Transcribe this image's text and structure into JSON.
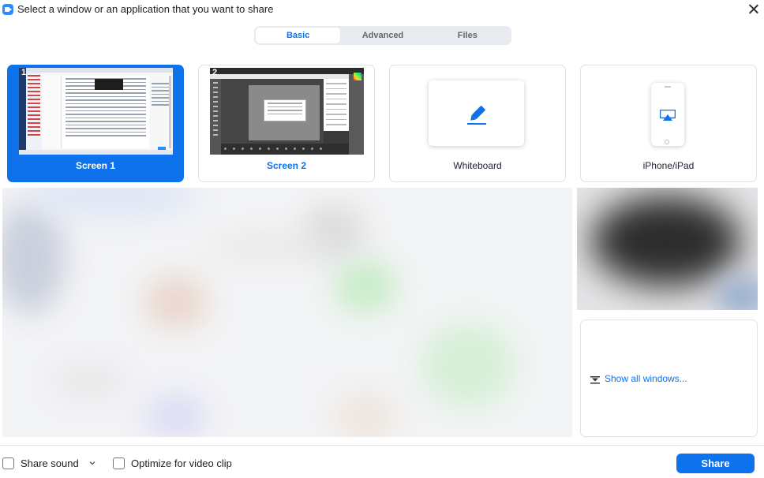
{
  "window": {
    "title": "Select a window or an application that you want to share",
    "app_icon": "zoom-camera-icon",
    "close_icon": "close-icon"
  },
  "tabs": [
    {
      "label": "Basic",
      "active": true
    },
    {
      "label": "Advanced",
      "active": false
    },
    {
      "label": "Files",
      "active": false
    }
  ],
  "cards": {
    "screen1": {
      "number": "1",
      "label": "Screen 1",
      "selected": true
    },
    "screen2": {
      "number": "2",
      "label": "Screen 2",
      "selected": false
    },
    "whiteboard": {
      "label": "Whiteboard",
      "icon": "pen-icon"
    },
    "iphone": {
      "label": "iPhone/iPad",
      "icon": "airplay-icon"
    }
  },
  "show_all": {
    "label": "Show all windows...",
    "icon": "expand-down-icon"
  },
  "footer": {
    "share_sound_label": "Share sound",
    "optimize_label": "Optimize for video clip",
    "share_button": "Share",
    "share_sound_checked": false,
    "optimize_checked": false
  },
  "colors": {
    "accent": "#0e72ed",
    "brand": "#2d8cff"
  }
}
